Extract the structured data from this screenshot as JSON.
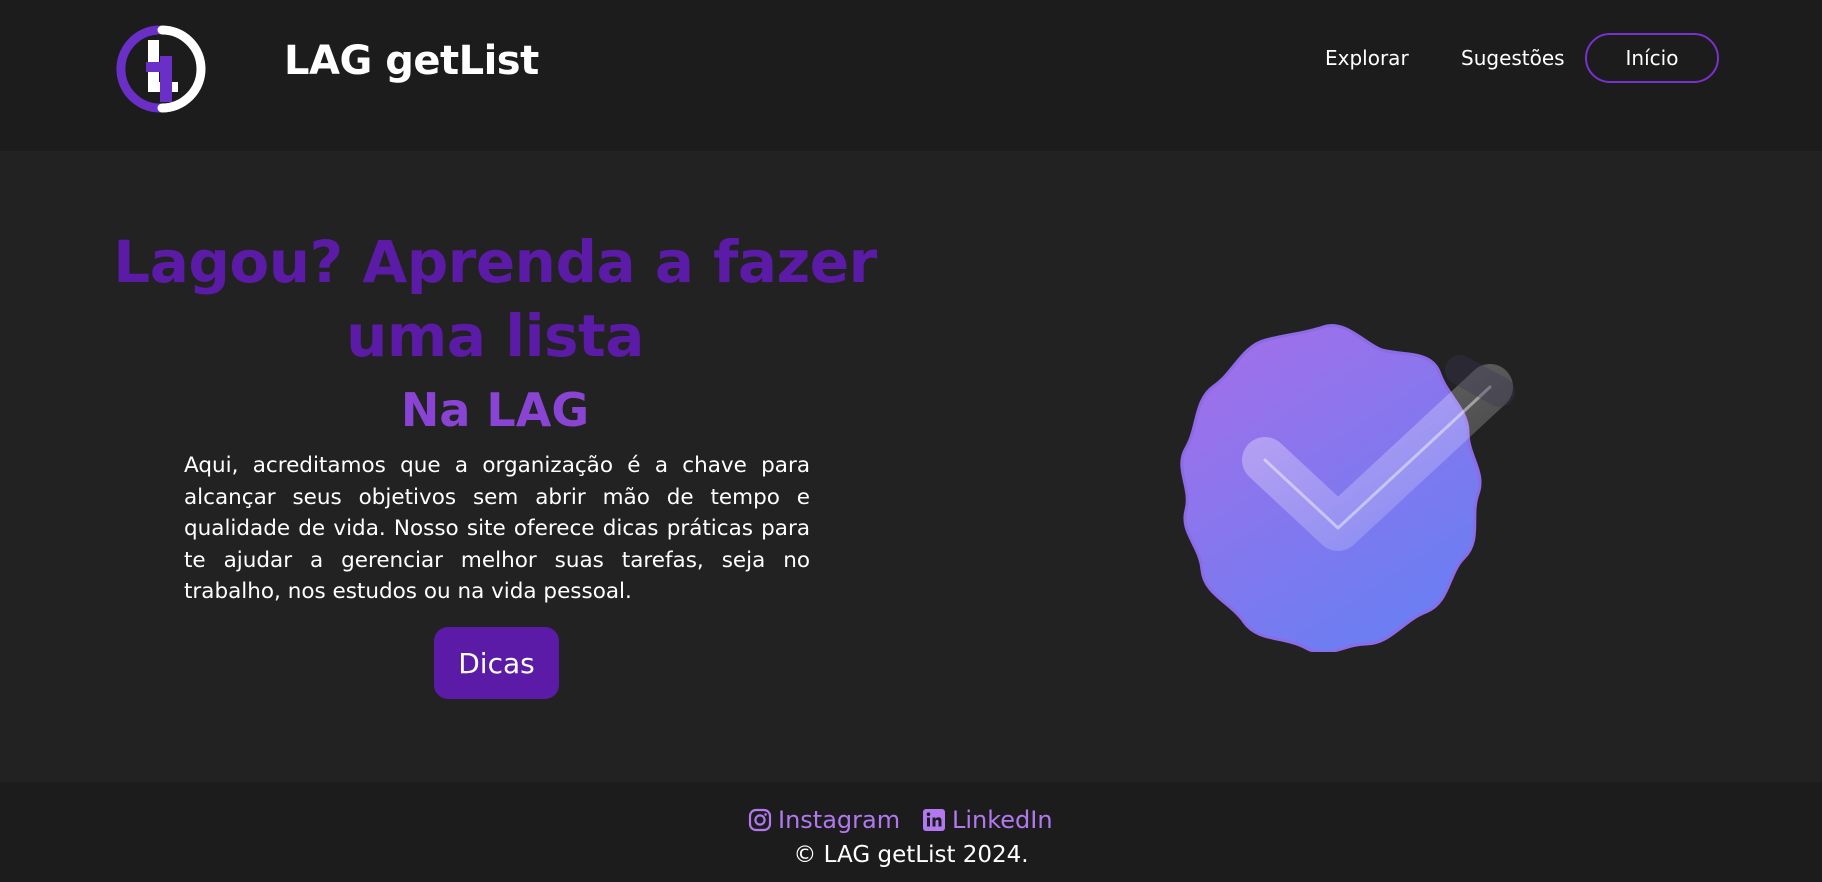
{
  "header": {
    "brand": "LAG getList",
    "nav": {
      "explorar": "Explorar",
      "sugestoes": "Sugestões",
      "inicio": "Início"
    }
  },
  "hero": {
    "title": "Lagou? Aprenda a fazer uma lista",
    "subtitle": "Na LAG",
    "description": "Aqui, acreditamos que a organização é a chave para alcançar seus objetivos sem abrir mão de tempo e qualidade de vida. Nosso site oferece dicas práticas para te ajudar a gerenciar melhor suas tarefas, seja no trabalho, nos estudos ou na vida pessoal.",
    "cta": "Dicas"
  },
  "footer": {
    "instagram": "Instagram",
    "linkedin": "LinkedIn",
    "copyright": "© LAG getList 2024."
  },
  "icons": {
    "logo": "lag-logo-icon",
    "badge": "verified-check-badge-icon",
    "instagram": "instagram-icon",
    "linkedin": "linkedin-icon"
  },
  "colors": {
    "accent": "#5b1ba6",
    "subtitle": "#8a44d4",
    "link": "#b278f0",
    "background": "#222222",
    "bars": "#1c1c1c"
  }
}
